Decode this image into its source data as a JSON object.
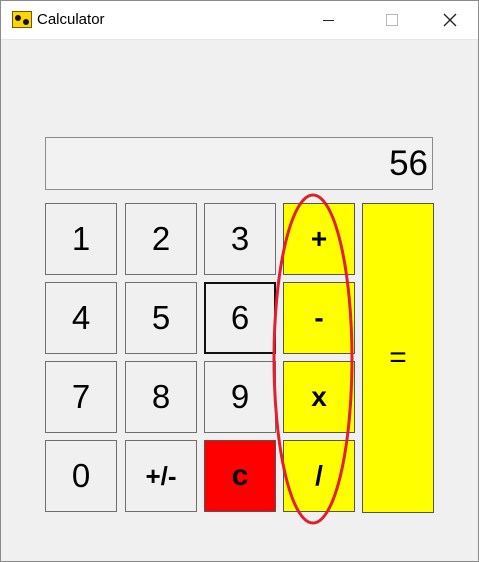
{
  "window": {
    "title": "Calculator",
    "minimize_label": "",
    "maximize_label": "",
    "close_label": ""
  },
  "display": {
    "value": "56"
  },
  "keys": {
    "k1": "1",
    "k2": "2",
    "k3": "3",
    "k4": "4",
    "k5": "5",
    "k6": "6",
    "k7": "7",
    "k8": "8",
    "k9": "9",
    "k0": "0",
    "negate": "+/-",
    "clear": "c",
    "add": "+",
    "subtract": "-",
    "multiply": "x",
    "divide": "/",
    "equals": "="
  },
  "colors": {
    "operator": "#ffff00",
    "clear": "#ff0000",
    "annotation": "#e0202a"
  },
  "icons": {
    "app": "calculator-app-icon",
    "minimize": "minimize-icon",
    "maximize": "maximize-icon",
    "close": "close-icon"
  }
}
